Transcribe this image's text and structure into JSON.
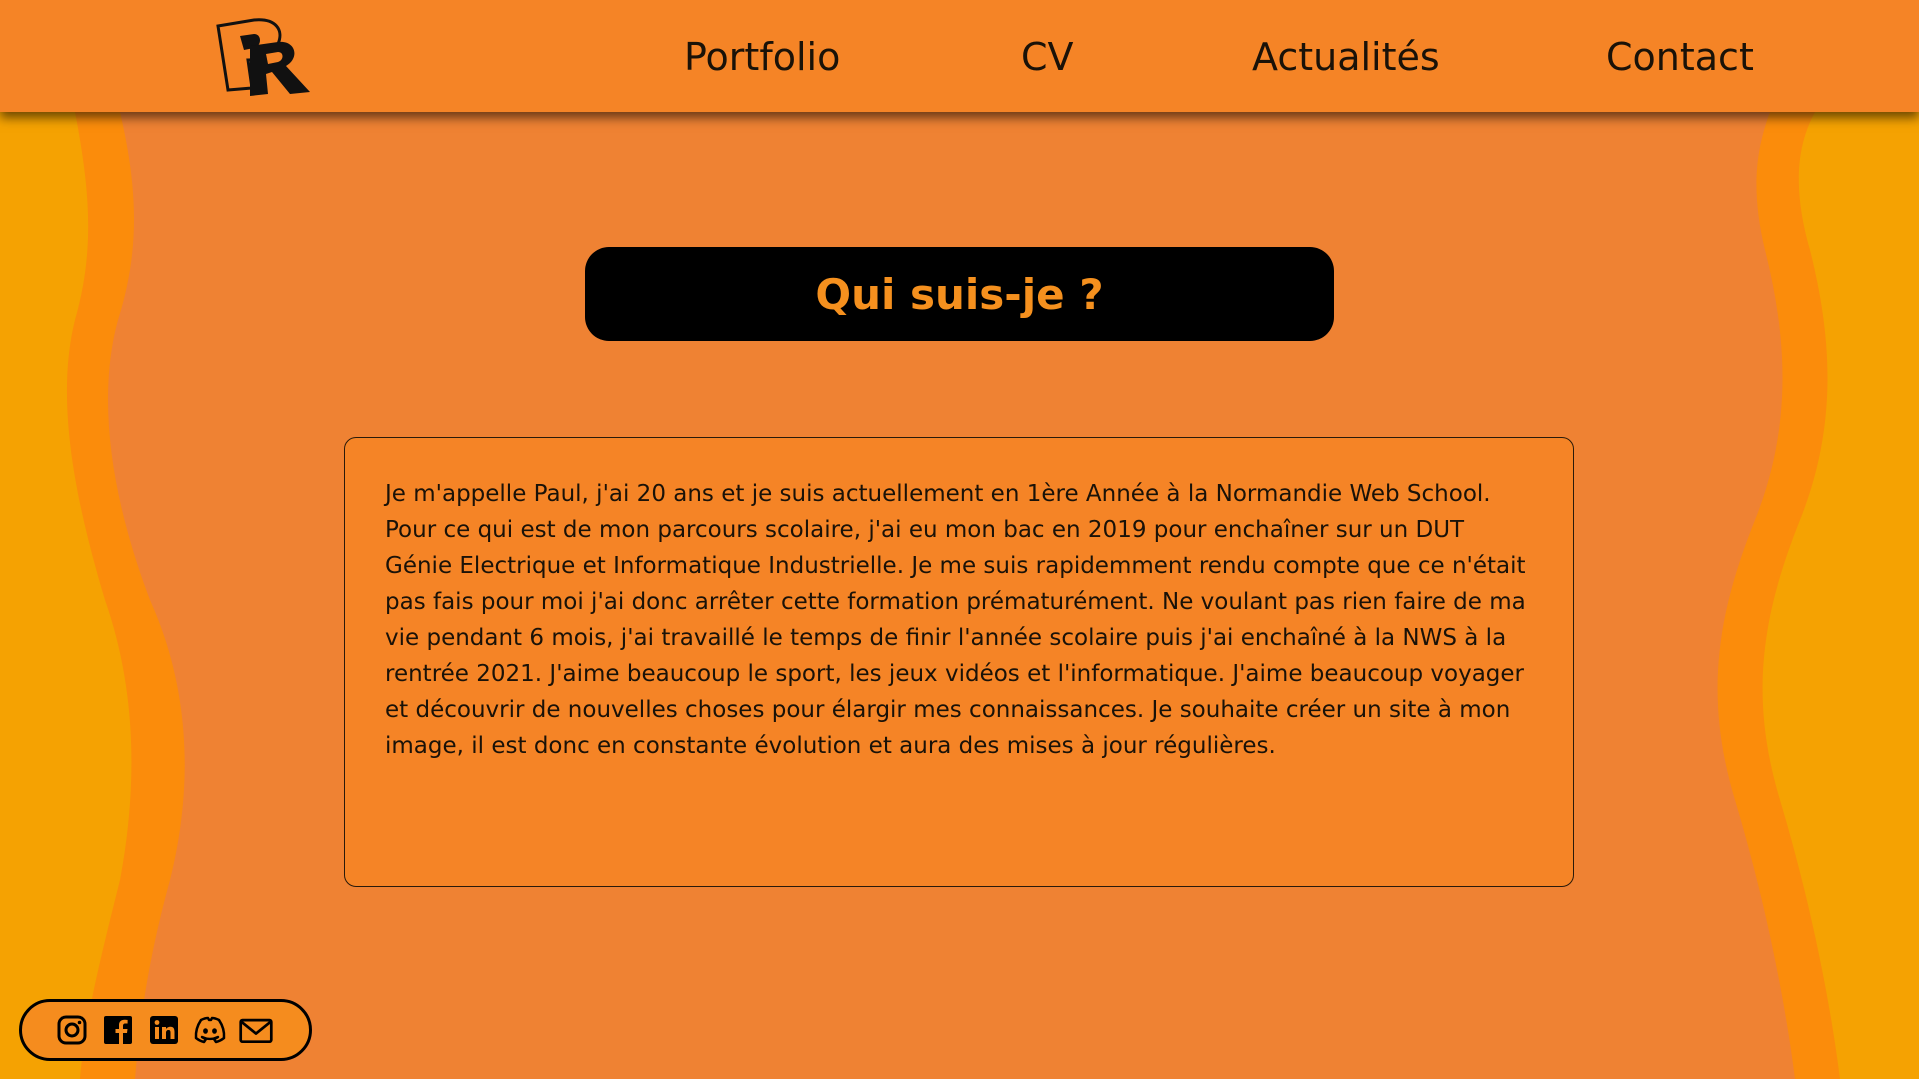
{
  "header": {
    "logo_letters": "PR",
    "nav": [
      {
        "label": "Portfolio"
      },
      {
        "label": "CV"
      },
      {
        "label": "Actualités"
      },
      {
        "label": "Contact"
      }
    ]
  },
  "main": {
    "title": "Qui suis-je ?",
    "bio": "Je m'appelle Paul, j'ai 20 ans et je suis actuellement en 1ère Année à la Normandie Web School. Pour ce qui est de mon parcours scolaire, j'ai eu mon bac en 2019 pour enchaîner sur un DUT Génie Electrique et Informatique Industrielle. Je me suis rapidemment rendu compte que ce n'était pas fais pour moi j'ai donc arrêter cette formation prématurément. Ne voulant pas rien faire de ma vie pendant 6 mois, j'ai travaillé le temps de finir l'année scolaire puis j'ai enchaîné à la NWS à la rentrée 2021. J'aime beaucoup le sport, les jeux vidéos et l'informatique. J'aime beaucoup voyager et découvrir de nouvelles choses pour élargir mes connaissances. Je souhaite créer un site à mon image, il est donc en constante évolution et aura des mises à jour régulières."
  },
  "social": {
    "icons": [
      "instagram-icon",
      "facebook-icon",
      "linkedin-icon",
      "discord-icon",
      "mail-icon"
    ]
  },
  "colors": {
    "header_bg": "#f58426",
    "page_center": "#ef8233",
    "wave_outer": "#f5a202",
    "wave_mid": "#fb8c0b",
    "title_bg": "#000000",
    "title_text": "#f5901e",
    "text": "#1a1208"
  }
}
